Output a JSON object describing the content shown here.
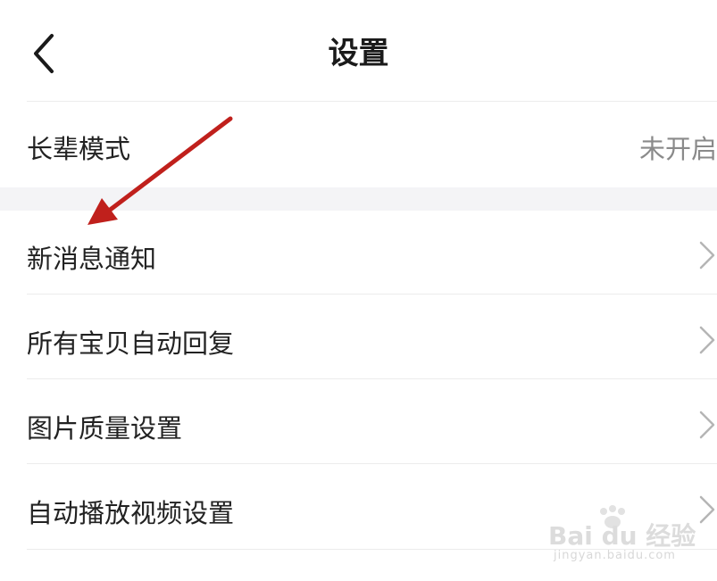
{
  "header": {
    "title": "设置",
    "back_icon": "chevron-left-icon"
  },
  "elder_mode": {
    "label": "长辈模式",
    "value": "未开启"
  },
  "menu": [
    {
      "label": "新消息通知",
      "icon": "chevron-right-icon"
    },
    {
      "label": "所有宝贝自动回复",
      "icon": "chevron-right-icon"
    },
    {
      "label": "图片质量设置",
      "icon": "chevron-right-icon"
    },
    {
      "label": "自动播放视频设置",
      "icon": "chevron-right-icon"
    }
  ],
  "annotation": {
    "color": "#c0201c"
  },
  "watermark": {
    "logo": "Bai du 经验",
    "url": "jingyan.baidu.com"
  }
}
